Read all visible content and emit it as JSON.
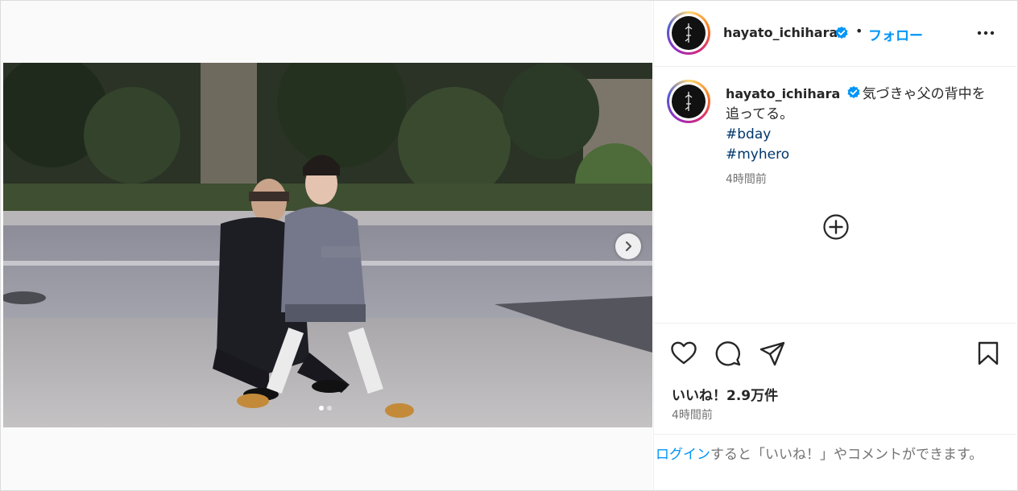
{
  "post": {
    "username": "hayato_ichihara",
    "verified": true,
    "follow_label": "フォロー",
    "separator": "•",
    "caption": {
      "username": "hayato_ichihara",
      "text": "気づきゃ父の背中を追ってる。",
      "hashtags": [
        "#bday",
        "#myhero"
      ],
      "time": "4時間前"
    },
    "likes_label": "いいね！2.9万件",
    "time": "4時間前",
    "carousel": {
      "total": 2,
      "current": 1
    }
  },
  "login_prompt": {
    "link": "ログイン",
    "text": "すると「いいね！」やコメントができます。"
  },
  "icons": {
    "more": "more-options-icon",
    "like": "heart-icon",
    "comment": "comment-icon",
    "share": "share-icon",
    "save": "bookmark-icon",
    "next": "chevron-right-icon",
    "add": "plus-circle-icon",
    "verified": "verified-badge-icon"
  },
  "colors": {
    "accent": "#0095f6",
    "hashtag": "#00376b",
    "muted": "#737373",
    "text": "#262626"
  }
}
